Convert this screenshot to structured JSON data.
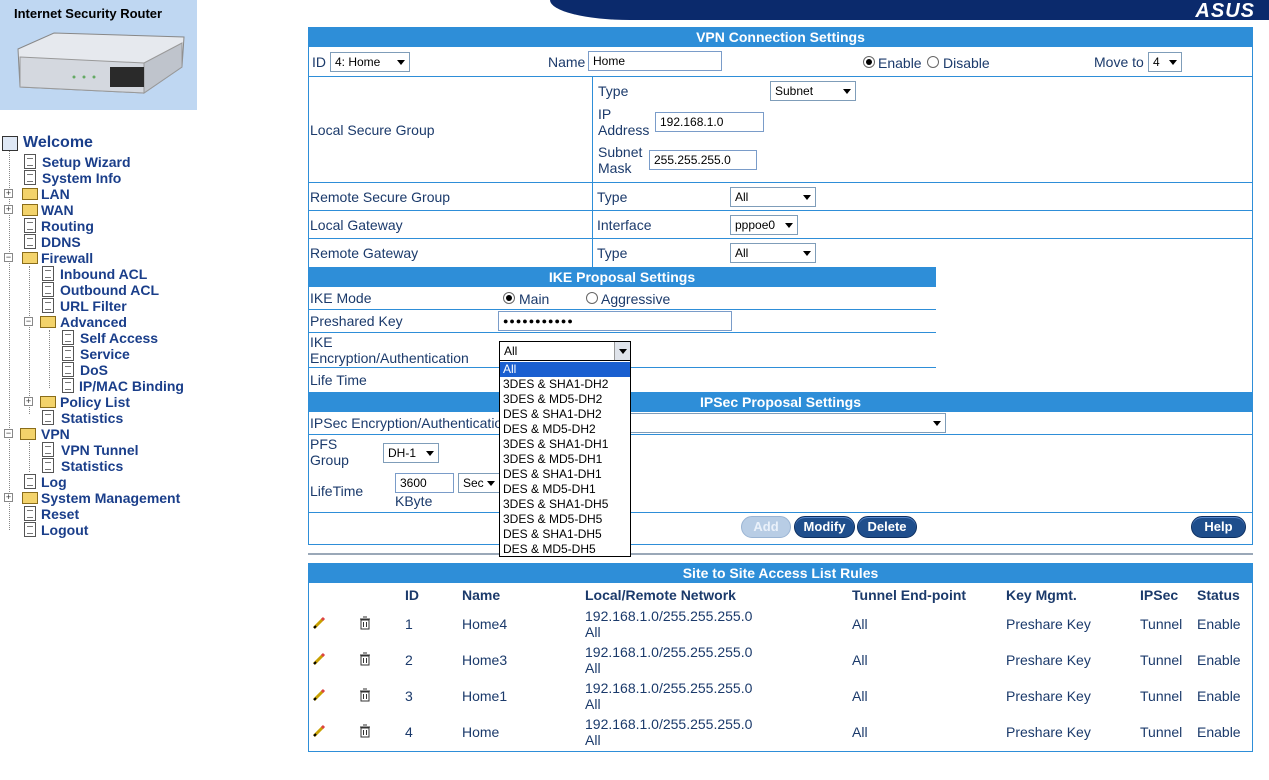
{
  "header": {
    "brand_title": "Internet Security Router",
    "vendor_logo": "ASUS"
  },
  "sidebar": {
    "items": [
      {
        "label": "Welcome",
        "icon": "computer-icon"
      },
      {
        "label": "Setup Wizard",
        "icon": "document-icon"
      },
      {
        "label": "System Info",
        "icon": "document-icon"
      },
      {
        "label": "LAN",
        "icon": "folder-icon"
      },
      {
        "label": "WAN",
        "icon": "folder-icon"
      },
      {
        "label": "Routing",
        "icon": "document-icon"
      },
      {
        "label": "DDNS",
        "icon": "document-icon"
      },
      {
        "label": "Firewall",
        "icon": "folder-open-icon"
      },
      {
        "label": "Inbound ACL",
        "icon": "document-icon"
      },
      {
        "label": "Outbound ACL",
        "icon": "document-icon"
      },
      {
        "label": "URL Filter",
        "icon": "document-icon"
      },
      {
        "label": "Advanced",
        "icon": "folder-open-icon"
      },
      {
        "label": "Self Access",
        "icon": "document-icon"
      },
      {
        "label": "Service",
        "icon": "document-icon"
      },
      {
        "label": "DoS",
        "icon": "document-icon"
      },
      {
        "label": "IP/MAC Binding",
        "icon": "document-icon"
      },
      {
        "label": "Policy List",
        "icon": "folder-icon"
      },
      {
        "label": "Statistics",
        "icon": "document-icon"
      },
      {
        "label": "VPN",
        "icon": "folder-open-icon"
      },
      {
        "label": "VPN Tunnel",
        "icon": "document-icon"
      },
      {
        "label": "Statistics",
        "icon": "document-icon"
      },
      {
        "label": "Log",
        "icon": "document-icon"
      },
      {
        "label": "System Management",
        "icon": "folder-icon"
      },
      {
        "label": "Reset",
        "icon": "document-icon"
      },
      {
        "label": "Logout",
        "icon": "document-icon"
      }
    ]
  },
  "vpn": {
    "title": "VPN Connection Settings",
    "id_label": "ID",
    "id_value": "4: Home",
    "name_label": "Name",
    "name_value": "Home",
    "enable_label": "Enable",
    "disable_label": "Disable",
    "move_label": "Move to",
    "move_value": "4",
    "local_secure_group": "Local Secure Group",
    "type_label": "Type",
    "local_type_value": "Subnet",
    "ip_label_1": "IP",
    "ip_label_2": "Address",
    "ip_value": "192.168.1.0",
    "mask_label_1": "Subnet",
    "mask_label_2": "Mask",
    "mask_value": "255.255.255.0",
    "remote_secure_group": "Remote Secure Group",
    "remote_type_value": "All",
    "local_gateway": "Local Gateway",
    "interface_label": "Interface",
    "interface_value": "pppoe0",
    "remote_gateway": "Remote Gateway",
    "remote_gw_type_value": "All"
  },
  "ike": {
    "title": "IKE Proposal Settings",
    "mode_label": "IKE Mode",
    "main_label": "Main",
    "aggressive_label": "Aggressive",
    "preshared_label": "Preshared Key",
    "preshared_value": "●●●●●●●●●●●",
    "enc_label_1": "IKE",
    "enc_label_2": "Encryption/Authentication",
    "enc_value": "All",
    "lifetime_label": "Life Time",
    "dropdown_options": [
      "All",
      "3DES & SHA1-DH2",
      "3DES & MD5-DH2",
      "DES & SHA1-DH2",
      "DES & MD5-DH2",
      "3DES & SHA1-DH1",
      "3DES & MD5-DH1",
      "DES & SHA1-DH1",
      "DES & MD5-DH1",
      "3DES & SHA1-DH5",
      "3DES & MD5-DH5",
      "DES & SHA1-DH5",
      "DES & MD5-DH5"
    ]
  },
  "ipsec": {
    "title": "IPSec Proposal Settings",
    "enc_label": "IPSec Encryption/Authentication",
    "pfs_label_1": "PFS",
    "pfs_label_2": "Group",
    "pfs_value": "DH-1",
    "lifetime_label": "LifeTime",
    "lifetime_value": "3600",
    "lifetime_unit": "Sec",
    "kbyte_label": "KByte"
  },
  "buttons": {
    "add": "Add",
    "modify": "Modify",
    "delete": "Delete",
    "help": "Help"
  },
  "rules": {
    "title": "Site to Site Access List Rules",
    "columns": [
      "ID",
      "Name",
      "Local/Remote Network",
      "Tunnel End-point",
      "Key Mgmt.",
      "IPSec",
      "Status"
    ],
    "rows": [
      {
        "id": "1",
        "name": "Home4",
        "local": "192.168.1.0/255.255.255.0",
        "remote": "All",
        "endpoint": "All",
        "key": "Preshare Key",
        "ipsec": "Tunnel",
        "status": "Enable"
      },
      {
        "id": "2",
        "name": "Home3",
        "local": "192.168.1.0/255.255.255.0",
        "remote": "All",
        "endpoint": "All",
        "key": "Preshare Key",
        "ipsec": "Tunnel",
        "status": "Enable"
      },
      {
        "id": "3",
        "name": "Home1",
        "local": "192.168.1.0/255.255.255.0",
        "remote": "All",
        "endpoint": "All",
        "key": "Preshare Key",
        "ipsec": "Tunnel",
        "status": "Enable"
      },
      {
        "id": "4",
        "name": "Home",
        "local": "192.168.1.0/255.255.255.0",
        "remote": "All",
        "endpoint": "All",
        "key": "Preshare Key",
        "ipsec": "Tunnel",
        "status": "Enable"
      }
    ]
  },
  "colors": {
    "accent": "#2e8ed8",
    "text": "#1b3a6b",
    "header_dark": "#0b2a6c",
    "button": "#1f4e8c"
  }
}
